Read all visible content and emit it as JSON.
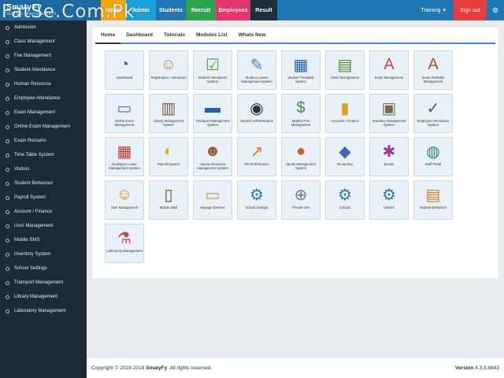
{
  "topbar": {
    "logo": "SmatyFy",
    "logo_sub": "School Management",
    "tabs": [
      "Home",
      "Admin",
      "Students",
      "Recruit",
      "Employees",
      "Result"
    ],
    "training": "Training",
    "signout": "Sign out"
  },
  "watermark": "FatSe.Com.Pk",
  "sidebar": {
    "items": [
      "Admission",
      "Class Management",
      "Fee Management",
      "Student Attendance",
      "Human Resource",
      "Employee Attendance",
      "Exam Management",
      "Online Exam Management",
      "Exam Remarks",
      "Time Table System",
      "Visitors",
      "Student Behaviour",
      "Payroll System",
      "Account / Finance",
      "User Management",
      "Mobile SMS",
      "Inventory System",
      "School Settings",
      "Transport Management",
      "Library Management",
      "Laboratory Management"
    ]
  },
  "main": {
    "tabs": [
      "Home",
      "Dashboard",
      "Tutorials",
      "Modules List",
      "Whats New"
    ],
    "tiles": [
      {
        "label": "Dashboard",
        "icon": "dashboard-icon",
        "color": "#2f6fa8"
      },
      {
        "label": "Registration / Admission",
        "icon": "registration-icon",
        "color": "#d9822b"
      },
      {
        "label": "Student Attendance System",
        "icon": "attendance-icon",
        "color": "#5a9c3a"
      },
      {
        "label": "Student Leaves Management System",
        "icon": "leaves-icon",
        "color": "#4a7fb5"
      },
      {
        "label": "Student Timetable System",
        "icon": "timetable-icon",
        "color": "#2b63b8"
      },
      {
        "label": "Class Management",
        "icon": "class-icon",
        "color": "#4e8a2e"
      },
      {
        "label": "Exam Management",
        "icon": "exam-icon",
        "color": "#c94a3a"
      },
      {
        "label": "Exam Remarks Management",
        "icon": "exam-remarks-icon",
        "color": "#c94a3a"
      },
      {
        "label": "Online Exam Management",
        "icon": "online-exam-icon",
        "color": "#3a7bc4"
      },
      {
        "label": "Library Management System",
        "icon": "library-icon",
        "color": "#7a5a3a"
      },
      {
        "label": "Transport Management System",
        "icon": "transport-icon",
        "color": "#2262a8"
      },
      {
        "label": "Student Administration",
        "icon": "student-admin-icon",
        "color": "#333333"
      },
      {
        "label": "Student Fee Management",
        "icon": "fee-icon",
        "color": "#3f8f3f"
      },
      {
        "label": "Accounts / Finance",
        "icon": "finance-icon",
        "color": "#e0a020"
      },
      {
        "label": "Inventory Management System",
        "icon": "inventory-icon",
        "color": "#7a6a4a"
      },
      {
        "label": "Employee Attendance System",
        "icon": "employee-attendance-icon",
        "color": "#2f6f2f"
      },
      {
        "label": "Employee Leave Management System",
        "icon": "employee-leave-icon",
        "color": "#c03a3a"
      },
      {
        "label": "Payroll System",
        "icon": "payroll-icon",
        "color": "#e0b030"
      },
      {
        "label": "Human Resource Management System",
        "icon": "hr-icon",
        "color": "#9a5a3a"
      },
      {
        "label": "HR Performance",
        "icon": "performance-icon",
        "color": "#e07a20"
      },
      {
        "label": "Sports Management System",
        "icon": "sports-icon",
        "color": "#d06020"
      },
      {
        "label": "ELearning",
        "icon": "elearning-icon",
        "color": "#3a6ab0"
      },
      {
        "label": "Events",
        "icon": "events-icon",
        "color": "#a03a8a"
      },
      {
        "label": "Staff Portal",
        "icon": "globe-icon",
        "color": "#2a8a6a"
      },
      {
        "label": "User Management",
        "icon": "user-management-icon",
        "color": "#d08a20"
      },
      {
        "label": "Mobile SMS",
        "icon": "mobile-sms-icon",
        "color": "#555555"
      },
      {
        "label": "Manage Devices",
        "icon": "devices-icon",
        "color": "#d0a030"
      },
      {
        "label": "School Settings",
        "icon": "gear-icon",
        "color": "#2a7ac0"
      },
      {
        "label": "Private Use",
        "icon": "lock-icon",
        "color": "#6a7a8a"
      },
      {
        "label": "Circular",
        "icon": "gear-icon",
        "color": "#2a7ac0"
      },
      {
        "label": "Visitors",
        "icon": "gear-icon",
        "color": "#2a7ac0"
      },
      {
        "label": "Student Behaviour",
        "icon": "id-card-icon",
        "color": "#e07a20"
      },
      {
        "label": "Laboratory Management",
        "icon": "laboratory-icon",
        "color": "#c04a4a"
      }
    ]
  },
  "footer": {
    "copyright_prefix": "Copyright © 2018-2019 ",
    "brand": "SmatyFy",
    "copyright_suffix": ". All rights reserved.",
    "version_label": "Version",
    "version_value": "4.3.8.8843"
  }
}
